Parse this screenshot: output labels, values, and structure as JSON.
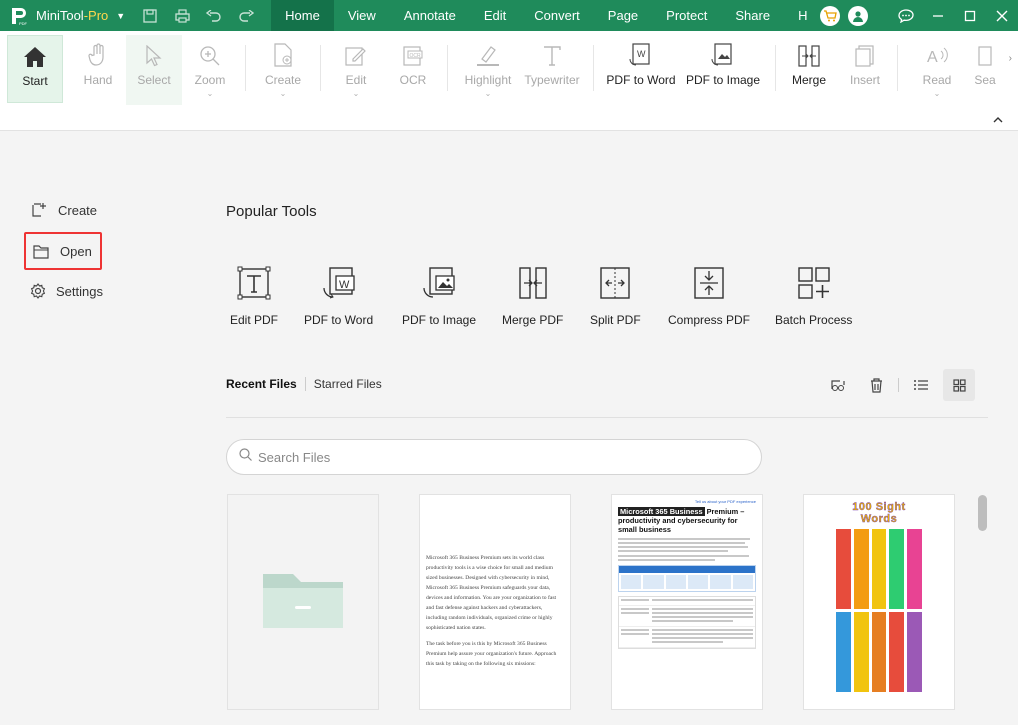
{
  "titlebar": {
    "app_name": "MiniTool",
    "app_edition": "-Pro",
    "menu_tabs": [
      "Home",
      "View",
      "Annotate",
      "Edit",
      "Convert",
      "Page",
      "Protect",
      "Share",
      "H"
    ],
    "active_tab": "Home"
  },
  "ribbon": {
    "items": [
      {
        "label": "Start"
      },
      {
        "label": "Hand"
      },
      {
        "label": "Select"
      },
      {
        "label": "Zoom"
      },
      {
        "label": "Create"
      },
      {
        "label": "Edit"
      },
      {
        "label": "OCR"
      },
      {
        "label": "Highlight"
      },
      {
        "label": "Typewriter"
      },
      {
        "label": "PDF to Word"
      },
      {
        "label": "PDF to Image"
      },
      {
        "label": "Merge"
      },
      {
        "label": "Insert"
      },
      {
        "label": "Read"
      },
      {
        "label": "Sea"
      }
    ]
  },
  "nav": {
    "items": [
      {
        "label": "Create"
      },
      {
        "label": "Open"
      },
      {
        "label": "Settings"
      }
    ]
  },
  "main": {
    "popular_title": "Popular Tools",
    "tools": [
      {
        "label": "Edit PDF"
      },
      {
        "label": "PDF to Word"
      },
      {
        "label": "PDF to Image"
      },
      {
        "label": "Merge PDF"
      },
      {
        "label": "Split PDF"
      },
      {
        "label": "Compress PDF"
      },
      {
        "label": "Batch Process"
      }
    ],
    "files_tabs": [
      "Recent Files",
      "Starred Files"
    ],
    "search_placeholder": "Search Files"
  },
  "thumbs": {
    "doc2_p1": "Microsoft 365 Business Premium sets its world class productivity tools is a wise choice for small and medium sized businesses. Designed with cybersecurity in mind, Microsoft 365 Business Premium safeguards your data, devices and information. You are your organization to fast and fast defense against hackers and cyberattackers, including random individuals, organized crime or highly sophisticated nation states.",
    "doc2_p2": "The task before you is this by Microsoft 365 Business Premium help assure your organization's future. Approach this task by taking on the following six missions:",
    "doc3_link": "Tell us about your PDF experience",
    "doc3_title_hl": "Microsoft 365 Business",
    "doc3_title_rest": " Premium – productivity and cybersecurity for small business",
    "doc4_title": "100 Sight Words"
  },
  "colors": {
    "brand": "#1f8b5b",
    "active_outline": "#e33333"
  }
}
